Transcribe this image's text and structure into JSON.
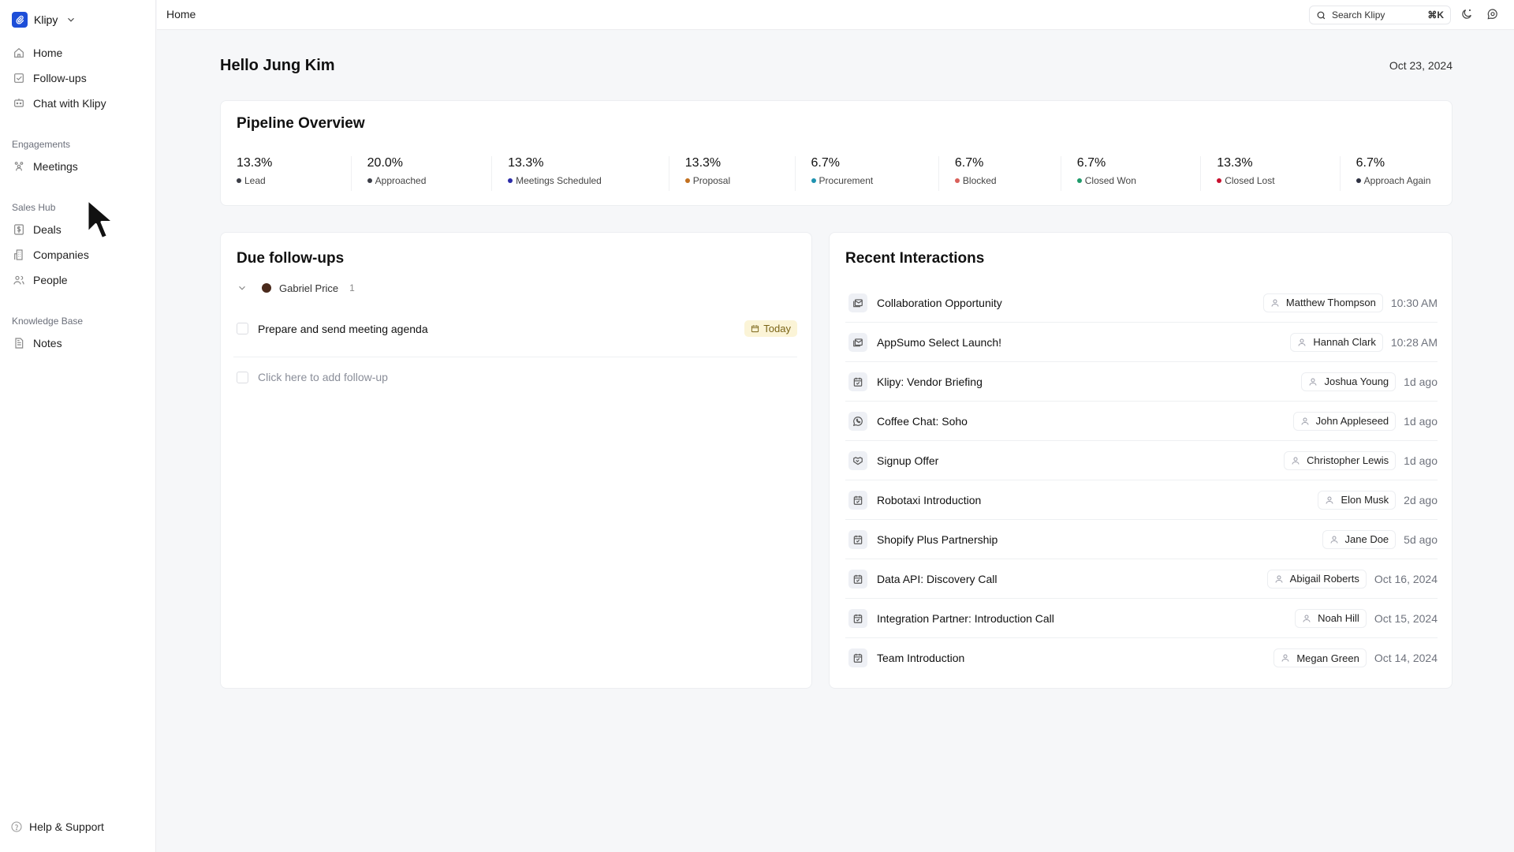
{
  "app": {
    "name": "Klipy"
  },
  "sidebar": {
    "main_items": [
      {
        "label": "Home",
        "icon": "home-icon"
      },
      {
        "label": "Follow-ups",
        "icon": "checkbox-icon"
      },
      {
        "label": "Chat with Klipy",
        "icon": "chat-bot-icon"
      }
    ],
    "sections": [
      {
        "label": "Engagements",
        "items": [
          {
            "label": "Meetings",
            "icon": "meetings-icon"
          }
        ]
      },
      {
        "label": "Sales Hub",
        "items": [
          {
            "label": "Deals",
            "icon": "dollar-icon"
          },
          {
            "label": "Companies",
            "icon": "building-icon"
          },
          {
            "label": "People",
            "icon": "people-icon"
          }
        ]
      },
      {
        "label": "Knowledge Base",
        "items": [
          {
            "label": "Notes",
            "icon": "document-icon"
          }
        ]
      }
    ],
    "help_label": "Help & Support"
  },
  "topbar": {
    "breadcrumb": "Home",
    "search_placeholder": "Search Klipy",
    "search_shortcut": "⌘K"
  },
  "main": {
    "greeting": "Hello Jung Kim",
    "date": "Oct 23, 2024"
  },
  "pipeline": {
    "title": "Pipeline Overview",
    "stages": [
      {
        "value": "13.3%",
        "label": "Lead",
        "color": "#3b3d46"
      },
      {
        "value": "20.0%",
        "label": "Approached",
        "color": "#3b3d46"
      },
      {
        "value": "13.3%",
        "label": "Meetings Scheduled",
        "color": "#2b2ba8"
      },
      {
        "value": "13.3%",
        "label": "Proposal",
        "color": "#c2701f"
      },
      {
        "value": "6.7%",
        "label": "Procurement",
        "color": "#1f93b0"
      },
      {
        "value": "6.7%",
        "label": "Blocked",
        "color": "#d9605a"
      },
      {
        "value": "6.7%",
        "label": "Closed Won",
        "color": "#1f9b6a"
      },
      {
        "value": "13.3%",
        "label": "Closed Lost",
        "color": "#c8102e"
      },
      {
        "value": "6.7%",
        "label": "Approach Again",
        "color": "#2e3142"
      }
    ]
  },
  "followups": {
    "title": "Due follow-ups",
    "group": {
      "name": "Gabriel Price",
      "count": "1"
    },
    "tasks": [
      {
        "label": "Prepare and send meeting agenda",
        "due": "Today"
      }
    ],
    "add_placeholder": "Click here to add follow-up"
  },
  "interactions": {
    "title": "Recent Interactions",
    "items": [
      {
        "title": "Collaboration Opportunity",
        "icon": "email-icon",
        "person": "Matthew Thompson",
        "time": "10:30 AM"
      },
      {
        "title": "AppSumo Select Launch!",
        "icon": "email-icon",
        "person": "Hannah Clark",
        "time": "10:28 AM"
      },
      {
        "title": "Klipy: Vendor Briefing",
        "icon": "calendar-check-icon",
        "person": "Joshua Young",
        "time": "1d ago"
      },
      {
        "title": "Coffee Chat: Soho",
        "icon": "whatsapp-icon",
        "person": "John Appleseed",
        "time": "1d ago"
      },
      {
        "title": "Signup Offer",
        "icon": "handshake-icon",
        "person": "Christopher Lewis",
        "time": "1d ago"
      },
      {
        "title": "Robotaxi Introduction",
        "icon": "calendar-check-icon",
        "person": "Elon Musk",
        "time": "2d ago"
      },
      {
        "title": "Shopify Plus Partnership",
        "icon": "calendar-check-icon",
        "person": "Jane Doe",
        "time": "5d ago"
      },
      {
        "title": "Data API: Discovery Call",
        "icon": "calendar-check-icon",
        "person": "Abigail Roberts",
        "time": "Oct 16, 2024"
      },
      {
        "title": "Integration Partner: Introduction Call",
        "icon": "calendar-check-icon",
        "person": "Noah Hill",
        "time": "Oct 15, 2024"
      },
      {
        "title": "Team Introduction",
        "icon": "calendar-check-icon",
        "person": "Megan Green",
        "time": "Oct 14, 2024"
      }
    ]
  }
}
